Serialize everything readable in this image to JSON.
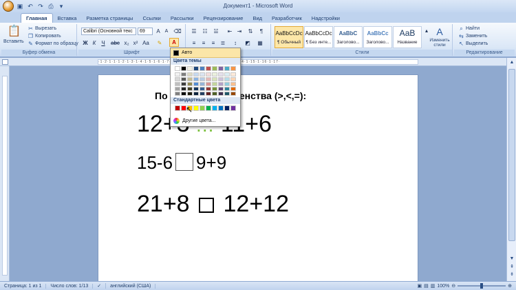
{
  "window": {
    "title": "Документ1 - Microsoft Word"
  },
  "tabs": [
    "Главная",
    "Вставка",
    "Разметка страницы",
    "Ссылки",
    "Рассылки",
    "Рецензирование",
    "Вид",
    "Разработчик",
    "Надстройки"
  ],
  "clipboard": {
    "paste": "Вставить",
    "cut": "Вырезать",
    "copy": "Копировать",
    "format_painter": "Формат по образцу",
    "label": "Буфер обмена"
  },
  "font": {
    "name": "Calibri (Основной текс",
    "size": "69",
    "label": "Шрифт"
  },
  "styles": {
    "label": "Стили",
    "items": [
      {
        "sample": "AaBbCcDc",
        "name": "¶ Обычный"
      },
      {
        "sample": "AaBbCcDc",
        "name": "¶ Без инте..."
      },
      {
        "sample": "AaBbC",
        "name": "Заголово..."
      },
      {
        "sample": "AaBbCc",
        "name": "Заголово..."
      },
      {
        "sample": "АаВ",
        "name": "Название"
      }
    ],
    "change": "Изменить стили"
  },
  "editing": {
    "find": "Найти",
    "replace": "Заменить",
    "select": "Выделить",
    "label": "Редактирование"
  },
  "color_popup": {
    "auto": "Авто",
    "theme_heading": "Цвета темы",
    "standard_heading": "Стандартные цвета",
    "more": "Другие цвета...",
    "theme_top": [
      "#ffffff",
      "#000000",
      "#eeece1",
      "#1f497d",
      "#4f81bd",
      "#c0504d",
      "#9bbb59",
      "#8064a2",
      "#4bacc6",
      "#f79646"
    ],
    "theme_shades": [
      [
        "#f2f2f2",
        "#7f7f7f",
        "#ddd9c3",
        "#c6d9f0",
        "#dbe5f1",
        "#f2dcdb",
        "#ebf1dd",
        "#e5e0ec",
        "#dbeef3",
        "#fdeada"
      ],
      [
        "#d8d8d8",
        "#595959",
        "#c4bd97",
        "#8db3e2",
        "#b8cce4",
        "#e5b9b7",
        "#d7e3bc",
        "#ccc1d9",
        "#b7dde8",
        "#fbd5b5"
      ],
      [
        "#bfbfbf",
        "#3f3f3f",
        "#938953",
        "#548dd4",
        "#95b3d7",
        "#d99694",
        "#c3d69b",
        "#b2a2c7",
        "#92cddc",
        "#fac08f"
      ],
      [
        "#a5a5a5",
        "#262626",
        "#494429",
        "#17365d",
        "#366092",
        "#953734",
        "#76923c",
        "#5f497a",
        "#31859b",
        "#e36c09"
      ],
      [
        "#7f7f7f",
        "#0c0c0c",
        "#1d1b10",
        "#0f243e",
        "#244061",
        "#632423",
        "#4f6128",
        "#3f3151",
        "#205867",
        "#974806"
      ]
    ],
    "standard": [
      "#c00000",
      "#ff0000",
      "#ffc000",
      "#ffff00",
      "#92d050",
      "#00b050",
      "#00b0f0",
      "#0070c0",
      "#002060",
      "#7030a0"
    ]
  },
  "document": {
    "heading": "По          ьный знак равенства (>,<,=):",
    "line1_left": "12+3",
    "line1_mid": "...",
    "line1_right": "11+6",
    "line2_left": "15-6",
    "line2_right": "9+9",
    "line3_left": "21+8",
    "line3_right": "12+12"
  },
  "status": {
    "page": "Страница: 1 из 1",
    "words": "Число слов: 1/13",
    "lang": "английский (США)",
    "zoom": "100%"
  }
}
